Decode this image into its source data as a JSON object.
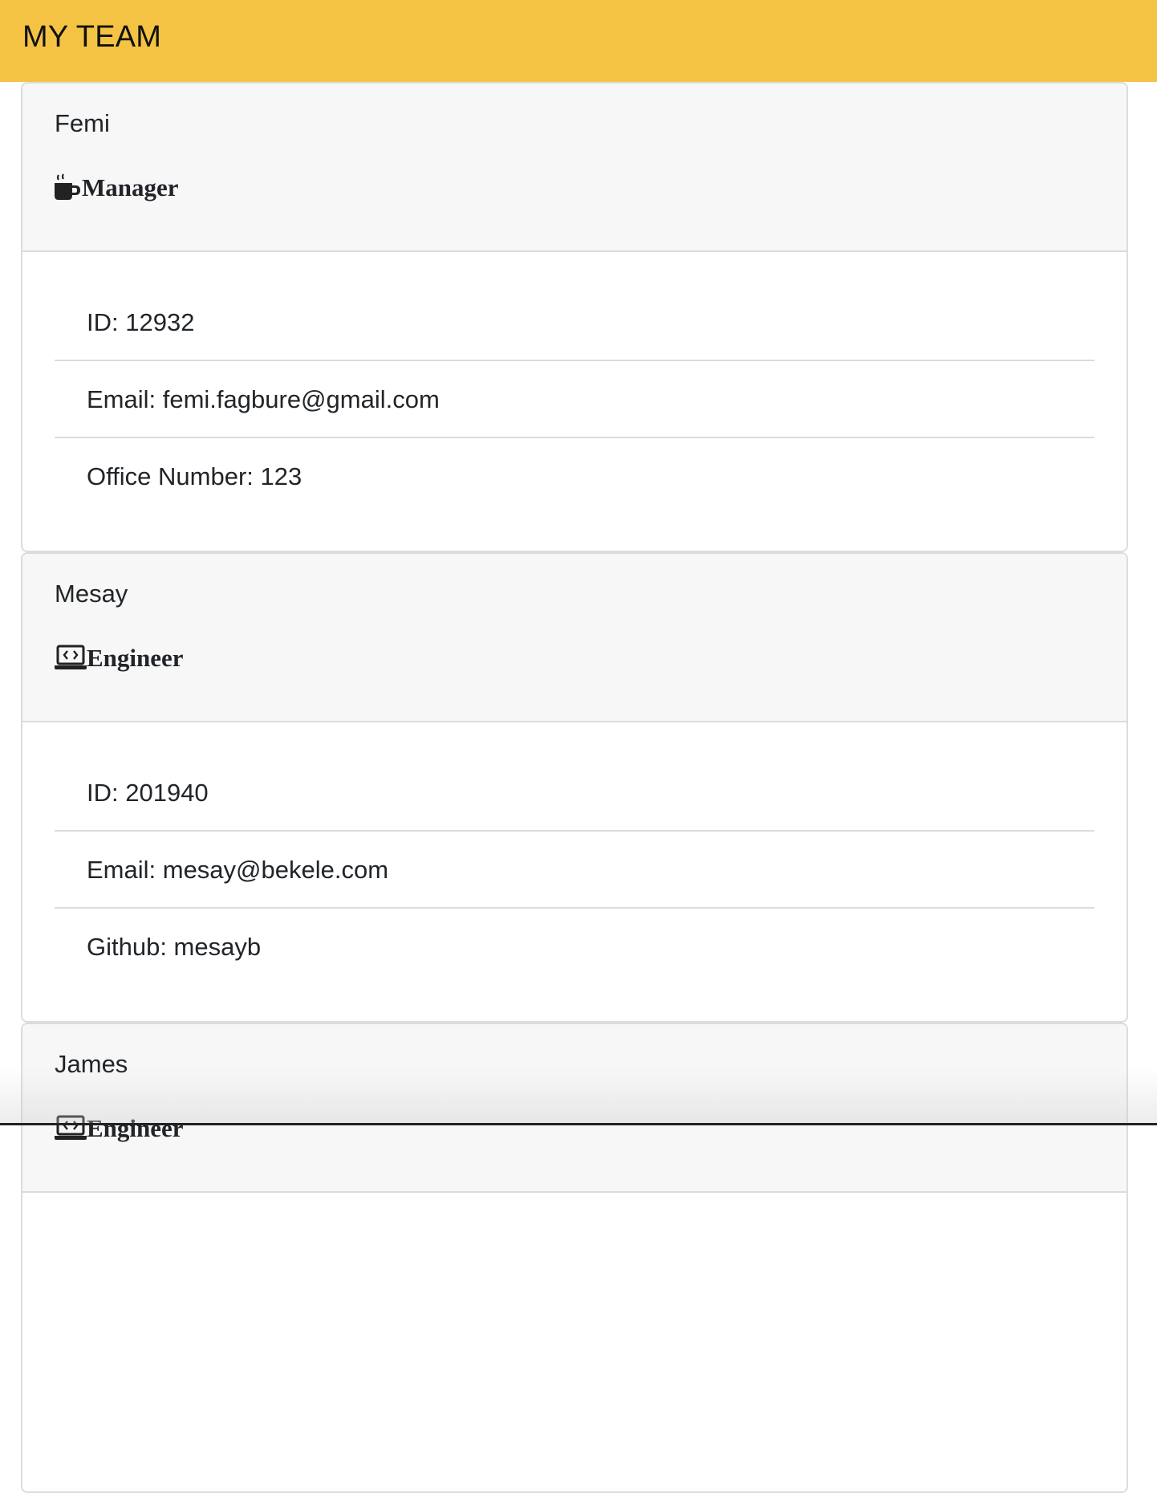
{
  "navbar": {
    "title": "MY TEAM"
  },
  "members": [
    {
      "name": "Femi",
      "role": "Manager",
      "role_icon": "coffee-mug-icon",
      "details": [
        "ID: 12932",
        "Email: femi.fagbure@gmail.com",
        "Office Number: 123"
      ]
    },
    {
      "name": "Mesay",
      "role": "Engineer",
      "role_icon": "laptop-code-icon",
      "details": [
        "ID: 201940",
        "Email: mesay@bekele.com",
        "Github: mesayb"
      ]
    },
    {
      "name": "James",
      "role": "Engineer",
      "role_icon": "laptop-code-icon",
      "details": []
    }
  ],
  "colors": {
    "navbar_bg": "#f5c344",
    "card_header_bg": "#f7f7f7",
    "border": "#dcdcdc",
    "text": "#212529"
  }
}
